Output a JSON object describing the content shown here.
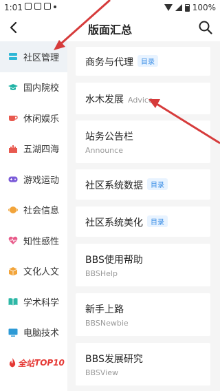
{
  "status_bar": {
    "time": "1:01",
    "battery": "100%"
  },
  "header": {
    "title": "版面汇总"
  },
  "sidebar": {
    "items": [
      {
        "label": "社区管理",
        "icon": "inbox-icon",
        "color": "#2db7d6"
      },
      {
        "label": "国内院校",
        "icon": "graduation-cap-icon",
        "color": "#20b3a6"
      },
      {
        "label": "休闲娱乐",
        "icon": "coffee-cup-icon",
        "color": "#e8594f"
      },
      {
        "label": "五湖四海",
        "icon": "castle-icon",
        "color": "#e8594f"
      },
      {
        "label": "游戏运动",
        "icon": "gamepad-icon",
        "color": "#7b5bd8"
      },
      {
        "label": "社会信息",
        "icon": "planet-icon",
        "color": "#f2a43a"
      },
      {
        "label": "知性感性",
        "icon": "heart-pulse-icon",
        "color": "#e85b8a"
      },
      {
        "label": "文化人文",
        "icon": "cube-icon",
        "color": "#f2a43a"
      },
      {
        "label": "学术科学",
        "icon": "open-book-icon",
        "color": "#2db7a6"
      },
      {
        "label": "电脑技术",
        "icon": "monitor-icon",
        "color": "#2d9ad6"
      }
    ],
    "top10": {
      "part1": "全站",
      "part2": "TOP10"
    }
  },
  "boards": [
    {
      "title": "商务与代理",
      "badge": "目录"
    },
    {
      "title": "水木发展",
      "sub_inline": "Advice"
    },
    {
      "title": "站务公告栏",
      "sub": "Announce"
    },
    {
      "title": "社区系统数据",
      "badge": "目录"
    },
    {
      "title": "社区系统美化",
      "badge": "目录"
    },
    {
      "title": "BBS使用帮助",
      "sub": "BBSHelp"
    },
    {
      "title": "新手上路",
      "sub": "BBSNewbie"
    },
    {
      "title": "BBS发展研究",
      "sub": "BBSView"
    }
  ],
  "colors": {
    "accent": "#3a8ee6",
    "arrow": "#d63b3b",
    "active_bg": "#eef2f6"
  }
}
